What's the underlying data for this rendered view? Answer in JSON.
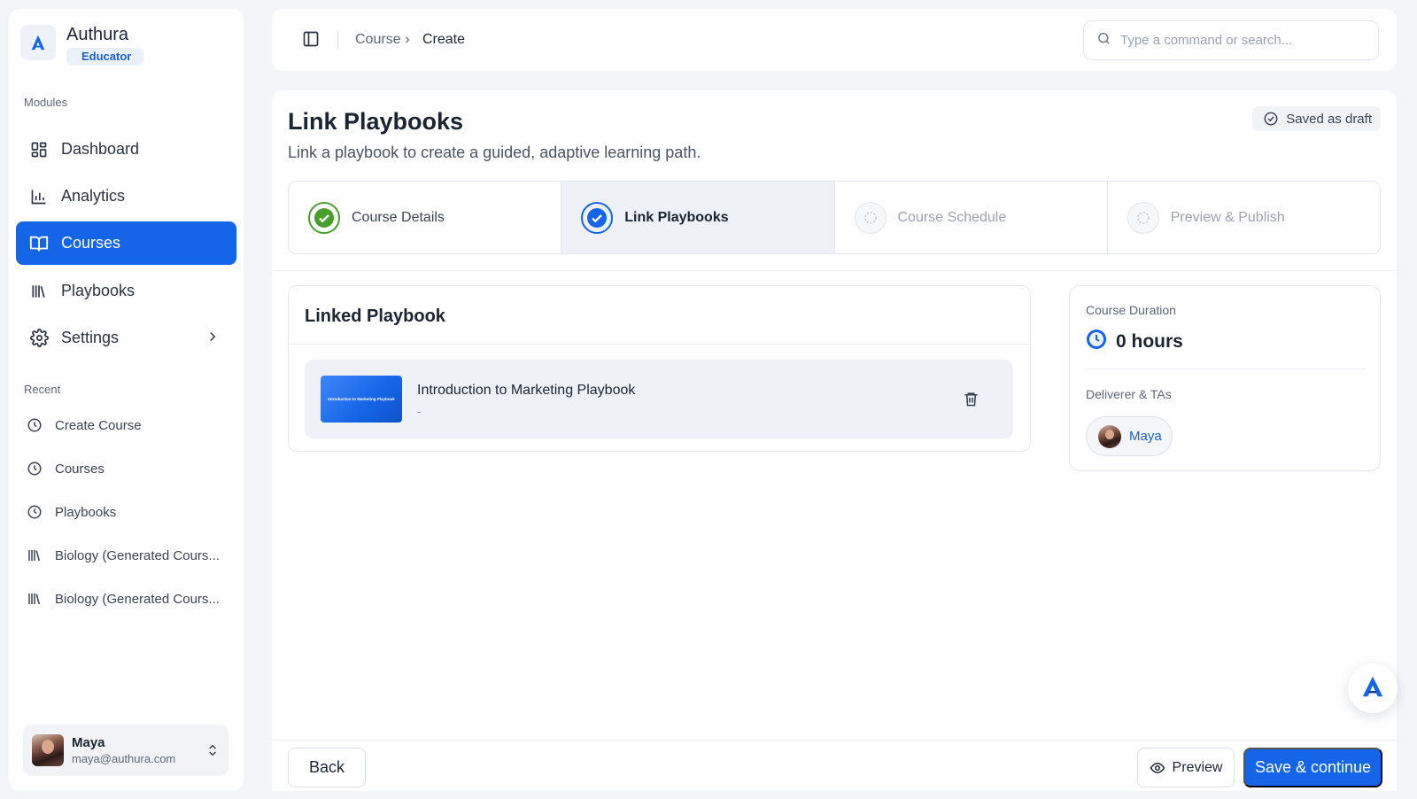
{
  "brand": {
    "name": "Authura",
    "role": "Educator"
  },
  "sidebar": {
    "modules_label": "Modules",
    "items": [
      {
        "label": "Dashboard",
        "icon": "dashboard-icon"
      },
      {
        "label": "Analytics",
        "icon": "bar-chart-icon"
      },
      {
        "label": "Courses",
        "icon": "book-open-icon",
        "active": true
      },
      {
        "label": "Playbooks",
        "icon": "library-icon"
      },
      {
        "label": "Settings",
        "icon": "gear-icon"
      }
    ],
    "recent_label": "Recent",
    "recent": [
      {
        "label": "Create Course",
        "icon": "clock-icon"
      },
      {
        "label": "Courses",
        "icon": "clock-icon"
      },
      {
        "label": "Playbooks",
        "icon": "clock-icon"
      },
      {
        "label": "Biology (Generated Cours...",
        "icon": "library-icon"
      },
      {
        "label": "Biology (Generated Cours...",
        "icon": "library-icon"
      }
    ]
  },
  "user": {
    "name": "Maya",
    "email": "maya@authura.com"
  },
  "topbar": {
    "breadcrumb": [
      "Course",
      "Create"
    ],
    "search_placeholder": "Type a command or search..."
  },
  "page": {
    "title": "Link Playbooks",
    "subtitle": "Link a playbook to create a guided, adaptive learning path.",
    "draft_status": "Saved as draft"
  },
  "steps": [
    {
      "label": "Course Details",
      "state": "done"
    },
    {
      "label": "Link Playbooks",
      "state": "current"
    },
    {
      "label": "Course Schedule",
      "state": "pending"
    },
    {
      "label": "Preview & Publish",
      "state": "pending"
    }
  ],
  "linked": {
    "title": "Linked Playbook",
    "playbook": {
      "name": "Introduction to Marketing Playbook",
      "meta": "-",
      "thumb_text": "Introduction to Marketing Playbook"
    }
  },
  "info": {
    "duration_label": "Course Duration",
    "duration_value": "0 hours",
    "team_label": "Deliverer & TAs",
    "team": [
      {
        "name": "Maya"
      }
    ]
  },
  "actions": {
    "back": "Back",
    "preview": "Preview",
    "save": "Save & continue"
  },
  "colors": {
    "primary": "#1565e8",
    "success": "#48a02b",
    "text": "#1b2433",
    "muted": "#5d6778"
  }
}
